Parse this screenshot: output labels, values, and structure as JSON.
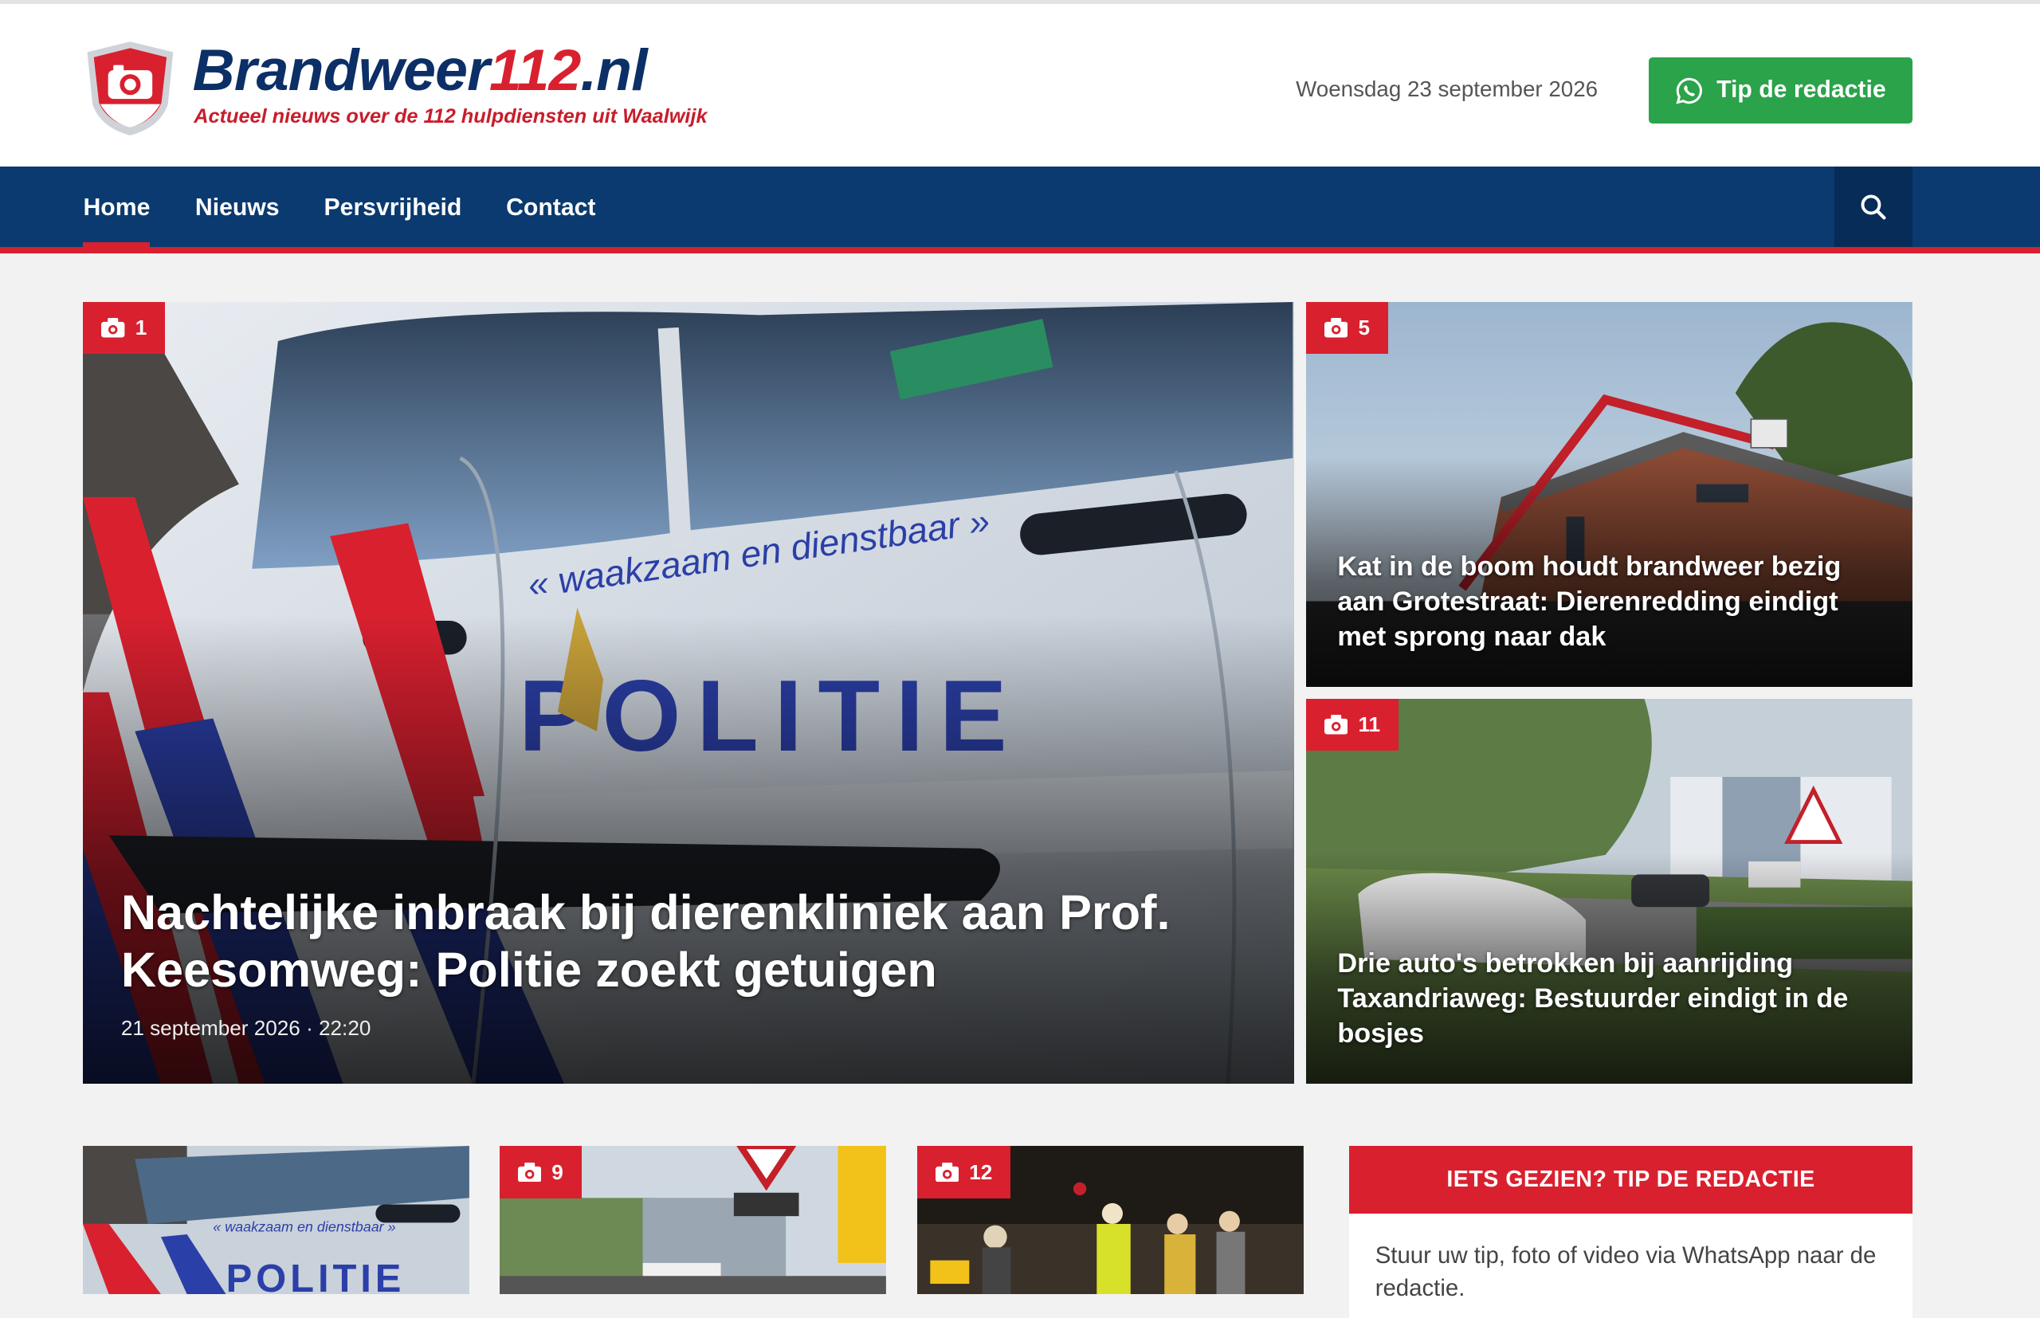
{
  "header": {
    "logo": {
      "brand": "Brandweer",
      "number": "112",
      "tld": ".nl",
      "tagline": "Actueel nieuws over de 112 hulpdiensten uit Waalwijk"
    },
    "date": "Woensdag 23 september 2026",
    "tip_button": {
      "label": "Tip de redactie",
      "icon": "whatsapp-icon",
      "color": "#2aa34a"
    }
  },
  "nav": {
    "items": [
      {
        "label": "Home",
        "active": true
      },
      {
        "label": "Nieuws",
        "active": false
      },
      {
        "label": "Persvrijheid",
        "active": false
      },
      {
        "label": "Contact",
        "active": false
      }
    ],
    "search_icon": "search-icon"
  },
  "featured": {
    "main": {
      "photo_count": "1",
      "title": "Nachtelijke inbraak bij dierenkliniek aan Prof. Keesomweg: Politie zoekt getuigen",
      "meta": "21 september 2026 · 22:20"
    },
    "side": [
      {
        "photo_count": "5",
        "title": "Kat in de boom houdt brandweer bezig aan Grotestraat: Dierenredding eindigt met sprong naar dak"
      },
      {
        "photo_count": "11",
        "title": "Drie auto's betrokken bij aanrijding Taxandriaweg: Bestuurder eindigt in de bosjes"
      }
    ]
  },
  "secondary": [
    {
      "photo_count": ""
    },
    {
      "photo_count": "9"
    },
    {
      "photo_count": "12"
    }
  ],
  "tipbox": {
    "heading": "IETS GEZIEN? TIP DE REDACTIE",
    "text": "Stuur uw tip, foto of video via WhatsApp naar de redactie."
  },
  "colors": {
    "navy": "#0a3a6f",
    "red": "#d9202f",
    "green": "#2aa34a"
  }
}
